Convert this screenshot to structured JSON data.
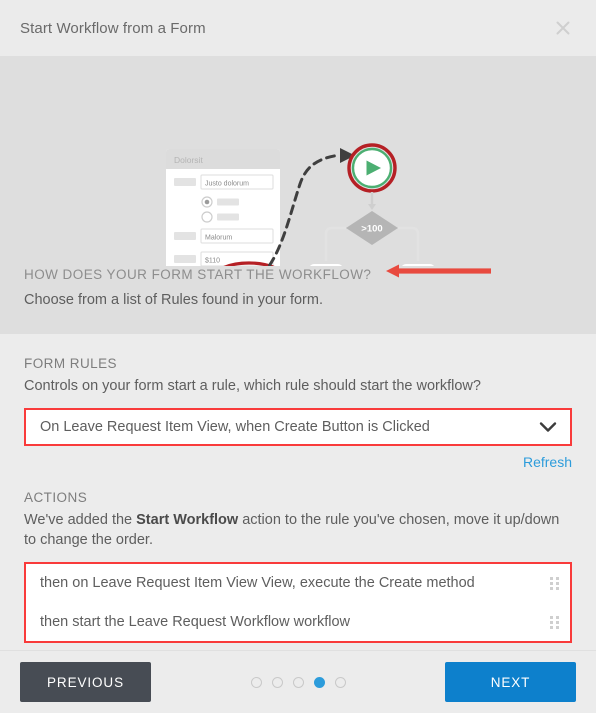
{
  "header": {
    "title": "Start Workflow from a Form",
    "close_icon": "close-icon"
  },
  "illustration": {
    "form_mock": {
      "header_label": "Dolorsit",
      "field_1_value": "Justo dolorum",
      "field_2_value": "Malorum",
      "field_3_value": "$110",
      "radio_1_selected": true,
      "radio_2_selected": false,
      "submit_button_label": ""
    },
    "workflow_mock": {
      "start_icon": "play-icon",
      "decision_label": ">100",
      "branch_1_icon": "envelope-icon",
      "branch_2_icon": "envelope-icon"
    },
    "highlight_color": "#b52025",
    "start_color": "#4caf72"
  },
  "caption": {
    "heading": "HOW DOES YOUR FORM START THE WORKFLOW?",
    "arrow_icon": "arrow-left-icon",
    "arrow_color": "#e84a3f",
    "subtext": "Choose from a list of Rules found in your form."
  },
  "form_rules": {
    "label": "FORM RULES",
    "description": "Controls on your form start a rule, which rule should start the workflow?",
    "selected_rule": "On Leave Request Item View, when Create Button is Clicked",
    "dropdown_icon": "chevron-down-icon",
    "refresh_label": "Refresh",
    "refresh_color": "#2d9cdb",
    "highlight_color": "#f93b3b"
  },
  "actions": {
    "label": "ACTIONS",
    "description_part_1": "We've added the ",
    "description_bold": "Start Workflow",
    "description_part_2": " action to the rule you've chosen, move it up/down to change the order.",
    "items": [
      {
        "text": "then on Leave Request Item View View, execute the Create method",
        "handle_icon": "drag-handle-icon"
      },
      {
        "text": "then start the Leave Request Workflow workflow",
        "handle_icon": "drag-handle-icon"
      }
    ],
    "highlight_color": "#f93b3b"
  },
  "footer": {
    "previous_label": "PREVIOUS",
    "next_label": "NEXT",
    "previous_color": "#474c54",
    "next_color": "#0d80cc",
    "steps_total": 5,
    "step_active_index": 4,
    "active_dot_color": "#2d9cdb"
  }
}
